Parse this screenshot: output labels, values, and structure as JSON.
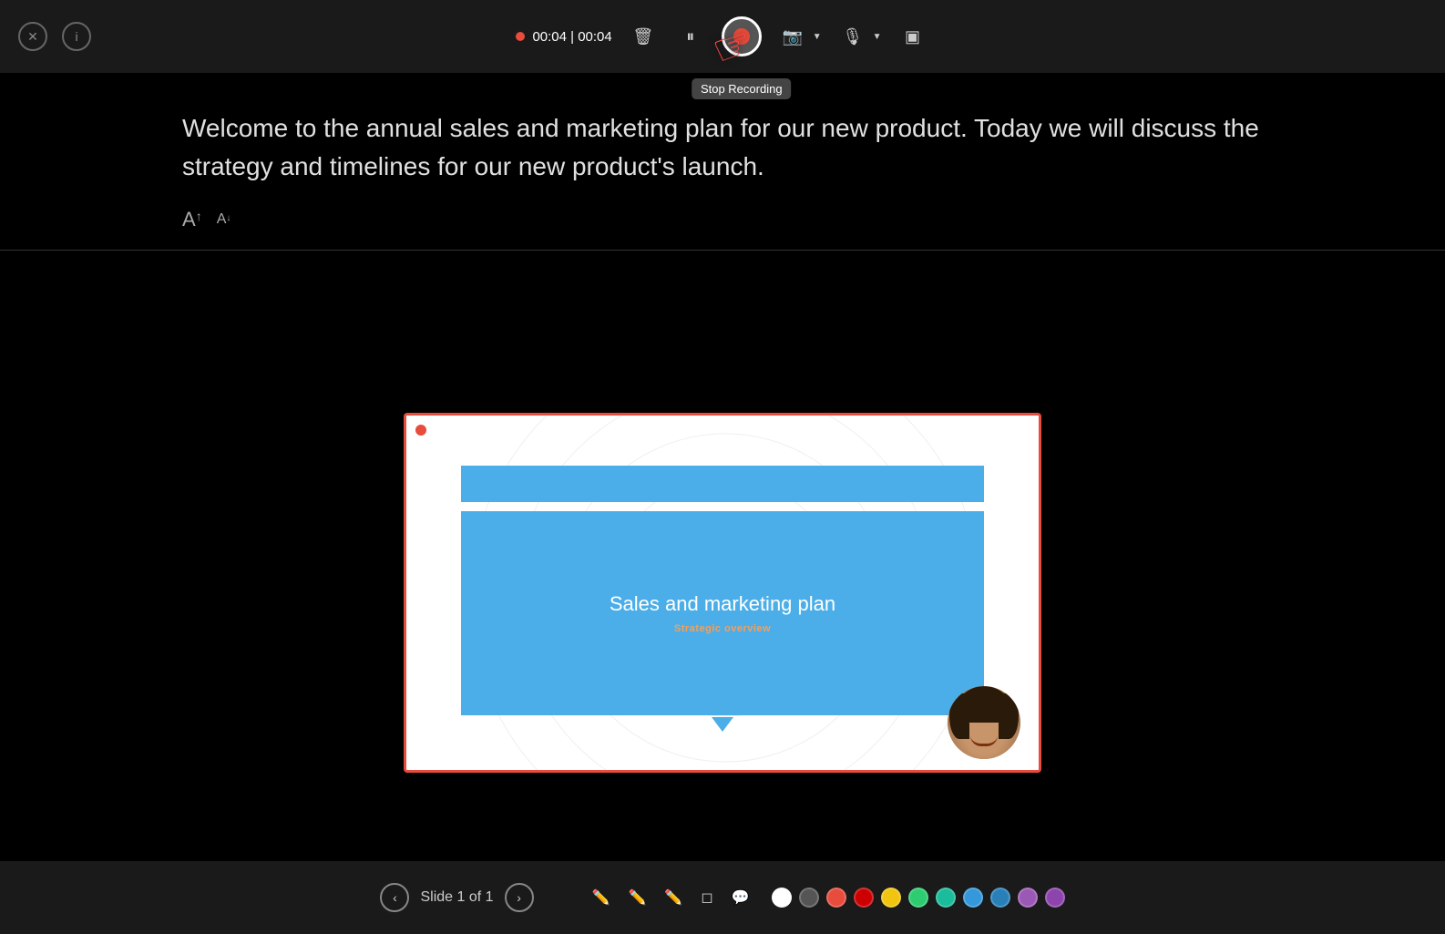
{
  "toolbar": {
    "close_label": "✕",
    "info_label": "ⓘ",
    "timer": "00:04 | 00:04",
    "delete_icon": "🗑",
    "pause_icon": "⏸",
    "camera_icon": "📷",
    "mic_icon": "🎙",
    "display_icon": "▣",
    "tooltip": "Stop Recording"
  },
  "notes": {
    "text": "Welcome to the annual sales and marketing plan for our new product. Today we will discuss the strategy and timelines for our new product's launch.",
    "font_increase": "A↑",
    "font_decrease": "A↓"
  },
  "slide": {
    "title": "Sales and marketing plan",
    "subtitle": "Strategic overview",
    "recording_indicator": true
  },
  "bottom_bar": {
    "slide_label": "Slide 1 of 1",
    "prev_arrow": "‹",
    "next_arrow": "›",
    "colors": [
      {
        "name": "white",
        "value": "#ffffff"
      },
      {
        "name": "dark-gray",
        "value": "#555555"
      },
      {
        "name": "red-orange",
        "value": "#e74c3c"
      },
      {
        "name": "red",
        "value": "#cc0000"
      },
      {
        "name": "yellow",
        "value": "#f1c40f"
      },
      {
        "name": "green-light",
        "value": "#2ecc71"
      },
      {
        "name": "teal",
        "value": "#1abc9c"
      },
      {
        "name": "blue",
        "value": "#3498db"
      },
      {
        "name": "blue-dark",
        "value": "#2980b9"
      },
      {
        "name": "purple",
        "value": "#9b59b6"
      },
      {
        "name": "dark-purple",
        "value": "#8e44ad"
      }
    ]
  }
}
